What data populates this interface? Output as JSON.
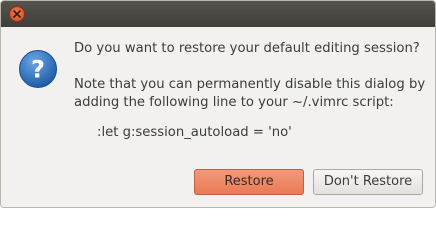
{
  "dialog": {
    "question": "Do you want to restore your default editing session?",
    "note_line1": "Note that you can permanently disable this dialog by",
    "note_line2": "adding the following line to your ~/.vimrc script:",
    "command": ":let g:session_autoload = 'no'"
  },
  "buttons": {
    "restore": "Restore",
    "dont_restore": "Don't Restore"
  },
  "icons": {
    "close": "close-icon",
    "question": "question-icon"
  },
  "colors": {
    "accent": "#ea7a54",
    "titlebar": "#3f3e3a",
    "dialog_bg": "#f2f1f0",
    "icon_blue": "#2d6eb5"
  }
}
